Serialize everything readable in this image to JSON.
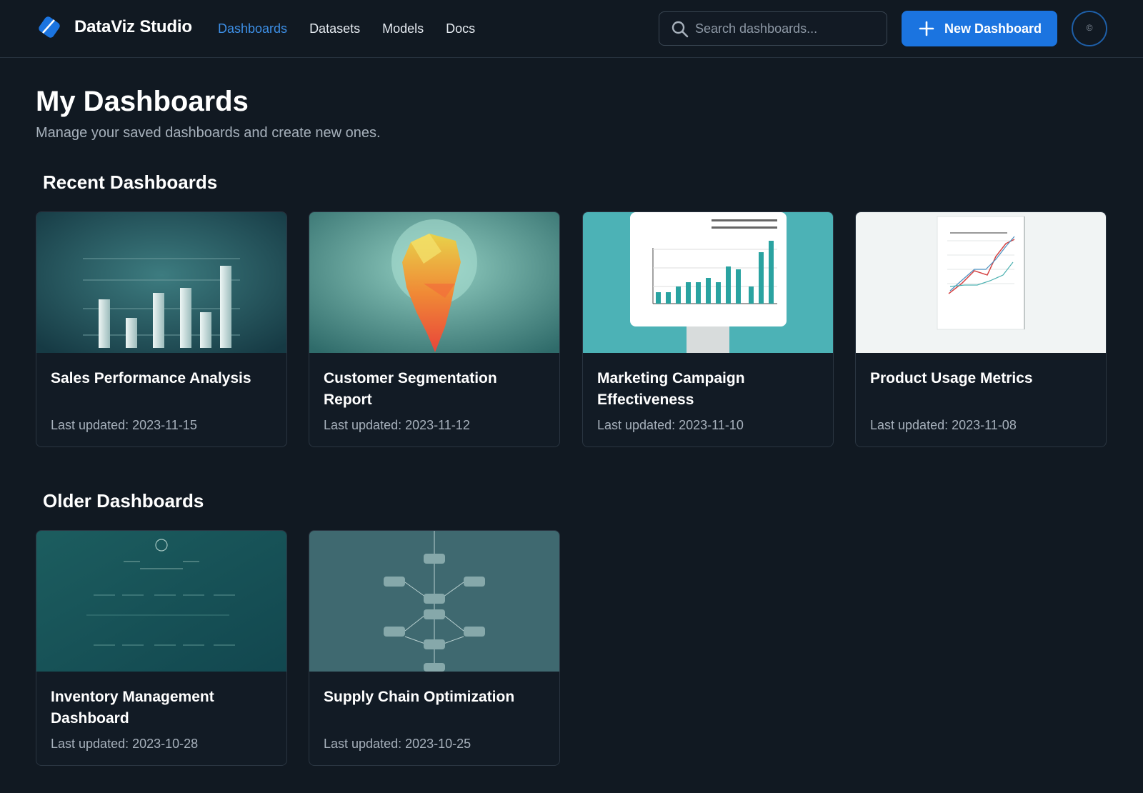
{
  "app": {
    "name": "DataViz Studio"
  },
  "nav": [
    {
      "label": "Dashboards",
      "active": true
    },
    {
      "label": "Datasets",
      "active": false
    },
    {
      "label": "Models",
      "active": false
    },
    {
      "label": "Docs",
      "active": false
    }
  ],
  "search": {
    "placeholder": "Search dashboards..."
  },
  "actions": {
    "new_dashboard": "New Dashboard"
  },
  "avatar": {
    "glyph": "©"
  },
  "page": {
    "title": "My Dashboards",
    "subtitle": "Manage your saved dashboards and create new ones."
  },
  "sections": {
    "recent": {
      "title": "Recent Dashboards",
      "cards": [
        {
          "title": "Sales Performance Analysis",
          "updated": "Last updated: 2023-11-15"
        },
        {
          "title": "Customer Segmentation Report",
          "updated": "Last updated: 2023-11-12"
        },
        {
          "title": "Marketing Campaign Effectiveness",
          "updated": "Last updated: 2023-11-10"
        },
        {
          "title": "Product Usage Metrics",
          "updated": "Last updated: 2023-11-08"
        }
      ]
    },
    "older": {
      "title": "Older Dashboards",
      "cards": [
        {
          "title": "Inventory Management Dashboard",
          "updated": "Last updated: 2023-10-28"
        },
        {
          "title": "Supply Chain Optimization",
          "updated": "Last updated: 2023-10-25"
        }
      ]
    }
  },
  "colors": {
    "background": "#111922",
    "accent": "#1b74e0",
    "active_nav": "#3d8fe6",
    "card_background": "#121b25",
    "muted_text": "#a7b1bc"
  },
  "icons": {
    "logo": "diamond-logo-icon",
    "search": "search-icon",
    "new": "plus-icon"
  }
}
